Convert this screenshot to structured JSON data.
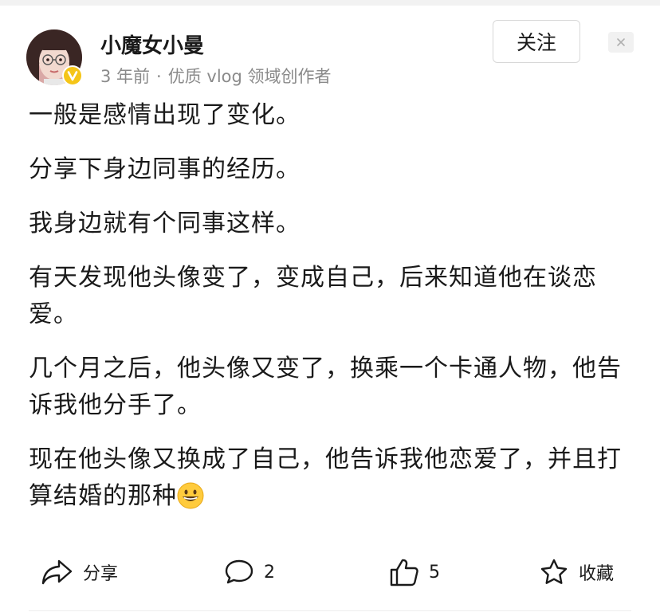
{
  "author": {
    "name": "小魔女小曼",
    "time_ago": "3 年前",
    "separator": "·",
    "title": "优质 vlog 领域创作者",
    "verified_badge_icon": "verified-v-icon",
    "badge_color": "#f5c518"
  },
  "header": {
    "follow_label": "关注",
    "close_icon": "close-icon"
  },
  "post": {
    "paragraphs": [
      "一般是感情出现了变化。",
      "分享下身边同事的经历。",
      "我身边就有个同事这样。",
      "有天发现他头像变了，变成自己，后来知道他在谈恋爱。",
      "几个月之后，他头像又变了，换乘一个卡通人物，他告诉我他分手了。",
      "现在他头像又换成了自己，他告诉我他恋爱了，并且打算结婚的那种"
    ],
    "trailing_emoji": "grinning-face-emoji"
  },
  "actions": {
    "share_label": "分享",
    "comment_count": "2",
    "like_count": "5",
    "favorite_label": "收藏"
  }
}
